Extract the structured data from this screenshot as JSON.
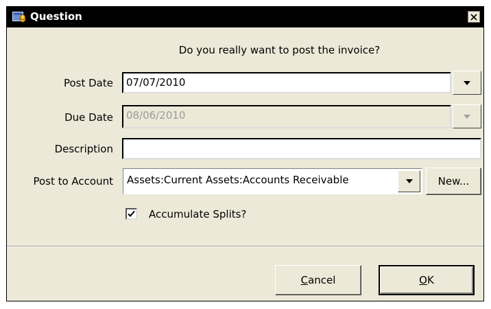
{
  "window": {
    "title": "Question",
    "close_label": "✕"
  },
  "dialog": {
    "question": "Do you really want to post the invoice?",
    "post_date": {
      "label": "Post Date",
      "value": "07/07/2010"
    },
    "due_date": {
      "label": "Due Date",
      "value": "08/06/2010"
    },
    "description": {
      "label": "Description",
      "value": ""
    },
    "post_to_account": {
      "label": "Post to Account",
      "value": "Assets:Current Assets:Accounts Receivable"
    },
    "new_button_label": "New...",
    "accumulate": {
      "label": "Accumulate Splits?",
      "checked": true
    },
    "cancel_button": {
      "mnemonic": "C",
      "rest": "ancel"
    },
    "ok_button": {
      "mnemonic": "O",
      "rest": "K"
    }
  },
  "icons": {
    "title": "app-window-icon",
    "close": "close-icon",
    "dropdown": "chevron-down-icon",
    "check": "checkmark-icon"
  }
}
